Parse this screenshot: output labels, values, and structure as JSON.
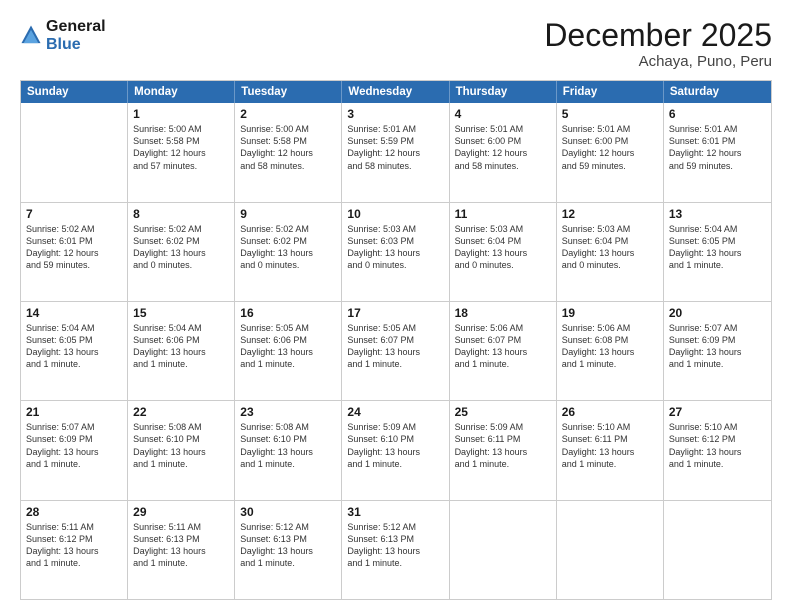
{
  "header": {
    "logo_line1": "General",
    "logo_line2": "Blue",
    "title": "December 2025",
    "subtitle": "Achaya, Puno, Peru"
  },
  "calendar": {
    "days_of_week": [
      "Sunday",
      "Monday",
      "Tuesday",
      "Wednesday",
      "Thursday",
      "Friday",
      "Saturday"
    ],
    "weeks": [
      [
        {
          "day": "",
          "lines": []
        },
        {
          "day": "1",
          "lines": [
            "Sunrise: 5:00 AM",
            "Sunset: 5:58 PM",
            "Daylight: 12 hours",
            "and 57 minutes."
          ]
        },
        {
          "day": "2",
          "lines": [
            "Sunrise: 5:00 AM",
            "Sunset: 5:58 PM",
            "Daylight: 12 hours",
            "and 58 minutes."
          ]
        },
        {
          "day": "3",
          "lines": [
            "Sunrise: 5:01 AM",
            "Sunset: 5:59 PM",
            "Daylight: 12 hours",
            "and 58 minutes."
          ]
        },
        {
          "day": "4",
          "lines": [
            "Sunrise: 5:01 AM",
            "Sunset: 6:00 PM",
            "Daylight: 12 hours",
            "and 58 minutes."
          ]
        },
        {
          "day": "5",
          "lines": [
            "Sunrise: 5:01 AM",
            "Sunset: 6:00 PM",
            "Daylight: 12 hours",
            "and 59 minutes."
          ]
        },
        {
          "day": "6",
          "lines": [
            "Sunrise: 5:01 AM",
            "Sunset: 6:01 PM",
            "Daylight: 12 hours",
            "and 59 minutes."
          ]
        }
      ],
      [
        {
          "day": "7",
          "lines": [
            "Sunrise: 5:02 AM",
            "Sunset: 6:01 PM",
            "Daylight: 12 hours",
            "and 59 minutes."
          ]
        },
        {
          "day": "8",
          "lines": [
            "Sunrise: 5:02 AM",
            "Sunset: 6:02 PM",
            "Daylight: 13 hours",
            "and 0 minutes."
          ]
        },
        {
          "day": "9",
          "lines": [
            "Sunrise: 5:02 AM",
            "Sunset: 6:02 PM",
            "Daylight: 13 hours",
            "and 0 minutes."
          ]
        },
        {
          "day": "10",
          "lines": [
            "Sunrise: 5:03 AM",
            "Sunset: 6:03 PM",
            "Daylight: 13 hours",
            "and 0 minutes."
          ]
        },
        {
          "day": "11",
          "lines": [
            "Sunrise: 5:03 AM",
            "Sunset: 6:04 PM",
            "Daylight: 13 hours",
            "and 0 minutes."
          ]
        },
        {
          "day": "12",
          "lines": [
            "Sunrise: 5:03 AM",
            "Sunset: 6:04 PM",
            "Daylight: 13 hours",
            "and 0 minutes."
          ]
        },
        {
          "day": "13",
          "lines": [
            "Sunrise: 5:04 AM",
            "Sunset: 6:05 PM",
            "Daylight: 13 hours",
            "and 1 minute."
          ]
        }
      ],
      [
        {
          "day": "14",
          "lines": [
            "Sunrise: 5:04 AM",
            "Sunset: 6:05 PM",
            "Daylight: 13 hours",
            "and 1 minute."
          ]
        },
        {
          "day": "15",
          "lines": [
            "Sunrise: 5:04 AM",
            "Sunset: 6:06 PM",
            "Daylight: 13 hours",
            "and 1 minute."
          ]
        },
        {
          "day": "16",
          "lines": [
            "Sunrise: 5:05 AM",
            "Sunset: 6:06 PM",
            "Daylight: 13 hours",
            "and 1 minute."
          ]
        },
        {
          "day": "17",
          "lines": [
            "Sunrise: 5:05 AM",
            "Sunset: 6:07 PM",
            "Daylight: 13 hours",
            "and 1 minute."
          ]
        },
        {
          "day": "18",
          "lines": [
            "Sunrise: 5:06 AM",
            "Sunset: 6:07 PM",
            "Daylight: 13 hours",
            "and 1 minute."
          ]
        },
        {
          "day": "19",
          "lines": [
            "Sunrise: 5:06 AM",
            "Sunset: 6:08 PM",
            "Daylight: 13 hours",
            "and 1 minute."
          ]
        },
        {
          "day": "20",
          "lines": [
            "Sunrise: 5:07 AM",
            "Sunset: 6:09 PM",
            "Daylight: 13 hours",
            "and 1 minute."
          ]
        }
      ],
      [
        {
          "day": "21",
          "lines": [
            "Sunrise: 5:07 AM",
            "Sunset: 6:09 PM",
            "Daylight: 13 hours",
            "and 1 minute."
          ]
        },
        {
          "day": "22",
          "lines": [
            "Sunrise: 5:08 AM",
            "Sunset: 6:10 PM",
            "Daylight: 13 hours",
            "and 1 minute."
          ]
        },
        {
          "day": "23",
          "lines": [
            "Sunrise: 5:08 AM",
            "Sunset: 6:10 PM",
            "Daylight: 13 hours",
            "and 1 minute."
          ]
        },
        {
          "day": "24",
          "lines": [
            "Sunrise: 5:09 AM",
            "Sunset: 6:10 PM",
            "Daylight: 13 hours",
            "and 1 minute."
          ]
        },
        {
          "day": "25",
          "lines": [
            "Sunrise: 5:09 AM",
            "Sunset: 6:11 PM",
            "Daylight: 13 hours",
            "and 1 minute."
          ]
        },
        {
          "day": "26",
          "lines": [
            "Sunrise: 5:10 AM",
            "Sunset: 6:11 PM",
            "Daylight: 13 hours",
            "and 1 minute."
          ]
        },
        {
          "day": "27",
          "lines": [
            "Sunrise: 5:10 AM",
            "Sunset: 6:12 PM",
            "Daylight: 13 hours",
            "and 1 minute."
          ]
        }
      ],
      [
        {
          "day": "28",
          "lines": [
            "Sunrise: 5:11 AM",
            "Sunset: 6:12 PM",
            "Daylight: 13 hours",
            "and 1 minute."
          ]
        },
        {
          "day": "29",
          "lines": [
            "Sunrise: 5:11 AM",
            "Sunset: 6:13 PM",
            "Daylight: 13 hours",
            "and 1 minute."
          ]
        },
        {
          "day": "30",
          "lines": [
            "Sunrise: 5:12 AM",
            "Sunset: 6:13 PM",
            "Daylight: 13 hours",
            "and 1 minute."
          ]
        },
        {
          "day": "31",
          "lines": [
            "Sunrise: 5:12 AM",
            "Sunset: 6:13 PM",
            "Daylight: 13 hours",
            "and 1 minute."
          ]
        },
        {
          "day": "",
          "lines": []
        },
        {
          "day": "",
          "lines": []
        },
        {
          "day": "",
          "lines": []
        }
      ]
    ]
  }
}
